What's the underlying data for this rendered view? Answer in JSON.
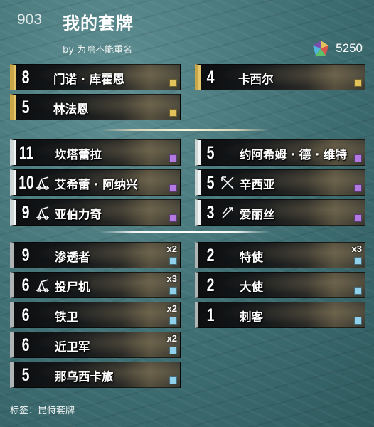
{
  "header": {
    "deck_id": "903",
    "title": "我的套牌",
    "author": "by 为啥不能重名",
    "cost": "5250",
    "cost_icon": "crafting-gem-icon"
  },
  "sections": {
    "gold": [
      {
        "power": "8",
        "name": "门诺 · 库霍恩",
        "rarity": "legendary"
      },
      {
        "power": "4",
        "name": "卡西尔",
        "rarity": "legendary"
      },
      {
        "power": "5",
        "name": "林法恩",
        "rarity": "legendary"
      }
    ],
    "silver": [
      {
        "power": "11",
        "name": "坎塔蕾拉",
        "rarity": "epic"
      },
      {
        "power": "5",
        "name": "约阿希姆 · 德 · 维特",
        "rarity": "epic"
      },
      {
        "power": "10",
        "name": "艾希蕾 · 阿纳兴",
        "rarity": "epic",
        "icon": "siege-icon"
      },
      {
        "power": "5",
        "name": "辛西亚",
        "rarity": "epic",
        "icon": "crossbow-icon"
      },
      {
        "power": "9",
        "name": "亚伯力奇",
        "rarity": "epic",
        "icon": "siege-icon"
      },
      {
        "power": "3",
        "name": "爱丽丝",
        "rarity": "epic",
        "icon": "ranged-icon"
      }
    ],
    "bronze": [
      {
        "power": "9",
        "name": "渗透者",
        "rarity": "common",
        "copies": "x2"
      },
      {
        "power": "2",
        "name": "特使",
        "rarity": "common",
        "copies": "x3"
      },
      {
        "power": "6",
        "name": "投尸机",
        "rarity": "common",
        "copies": "x3",
        "icon": "siege-icon"
      },
      {
        "power": "2",
        "name": "大使",
        "rarity": "common"
      },
      {
        "power": "6",
        "name": "铁卫",
        "rarity": "common",
        "copies": "x2"
      },
      {
        "power": "1",
        "name": "刺客",
        "rarity": "common"
      },
      {
        "power": "6",
        "name": "近卫军",
        "rarity": "common",
        "copies": "x2"
      },
      {
        "power": "5",
        "name": "那乌西卡旅",
        "rarity": "common"
      }
    ]
  },
  "footer": {
    "tag": "标签：昆特套牌"
  },
  "colors": {
    "background": "#3f6f73",
    "legendary": "#e2c25a",
    "epic": "#b279e0",
    "common": "#8fd0ea"
  }
}
